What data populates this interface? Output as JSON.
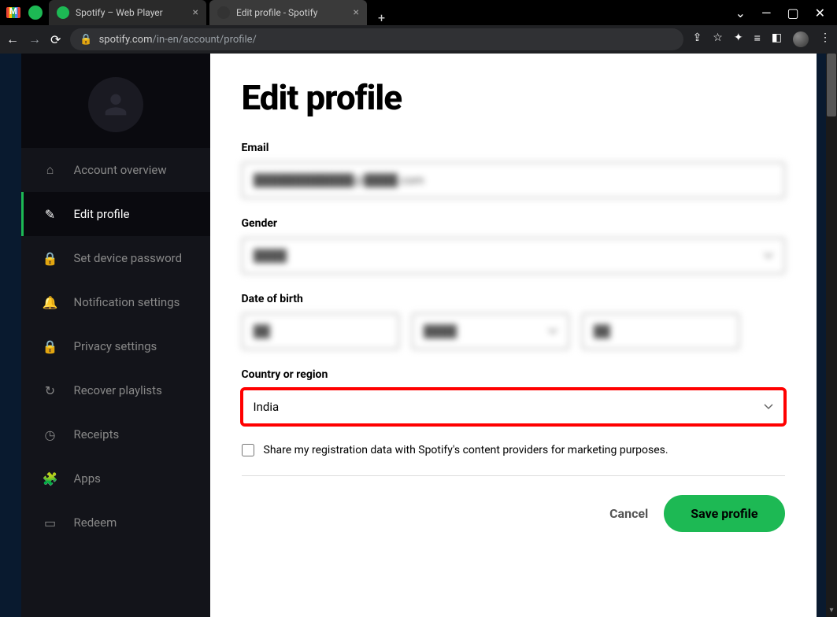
{
  "browser": {
    "tabs": [
      {
        "title": "Spotify – Web Player"
      },
      {
        "title": "Edit profile - Spotify"
      }
    ],
    "url_host": "spotify.com",
    "url_path": "/in-en/account/profile/"
  },
  "sidebar": {
    "items": [
      {
        "icon": "home",
        "label": "Account overview"
      },
      {
        "icon": "edit",
        "label": "Edit profile",
        "active": true
      },
      {
        "icon": "lock",
        "label": "Set device password"
      },
      {
        "icon": "bell",
        "label": "Notification settings"
      },
      {
        "icon": "lock",
        "label": "Privacy settings"
      },
      {
        "icon": "refresh",
        "label": "Recover playlists"
      },
      {
        "icon": "clock",
        "label": "Receipts"
      },
      {
        "icon": "puzzle",
        "label": "Apps"
      },
      {
        "icon": "card",
        "label": "Redeem"
      }
    ]
  },
  "form": {
    "title": "Edit profile",
    "email_label": "Email",
    "email_value": "████████████@████.com",
    "gender_label": "Gender",
    "gender_value": "████",
    "dob_label": "Date of birth",
    "dob_day": "██",
    "dob_month": "████",
    "dob_year": "██",
    "country_label": "Country or region",
    "country_value": "India",
    "checkbox_label": "Share my registration data with Spotify's content providers for marketing purposes.",
    "cancel_label": "Cancel",
    "save_label": "Save profile"
  }
}
